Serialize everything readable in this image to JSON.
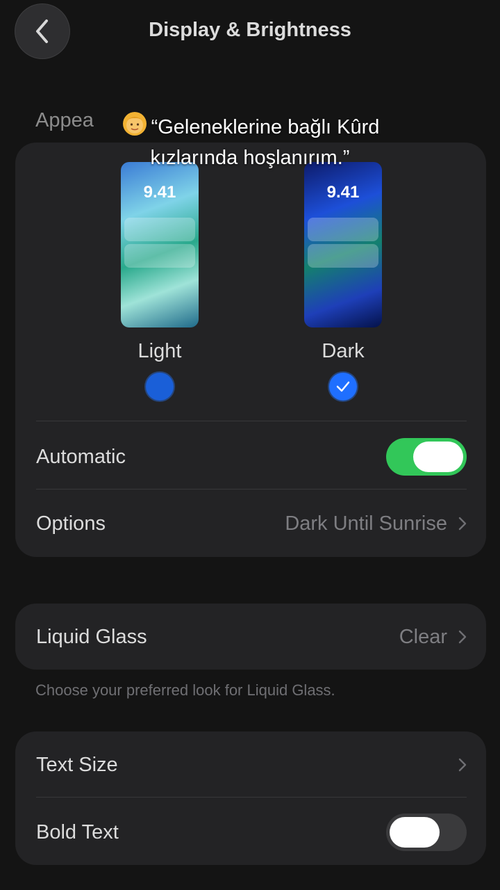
{
  "header": {
    "title": "Display & Brightness"
  },
  "appearance": {
    "section_label": "Appea",
    "overlay_line1": "“Geleneklerine bağlı Kûrd",
    "overlay_line2": "kızlarında hoşlanırım.”",
    "light": {
      "time": "9.41",
      "label": "Light",
      "selected": false
    },
    "dark": {
      "time": "9.41",
      "label": "Dark",
      "selected": true
    },
    "automatic": {
      "label": "Automatic",
      "on": true
    },
    "options": {
      "label": "Options",
      "value": "Dark Until Sunrise"
    }
  },
  "liquid_glass": {
    "label": "Liquid Glass",
    "value": "Clear",
    "note": "Choose your preferred look for Liquid Glass."
  },
  "text": {
    "text_size_label": "Text Size",
    "bold_text": {
      "label": "Bold Text",
      "on": false
    }
  },
  "colors": {
    "accent_blue": "#1f6fff",
    "toggle_on": "#32c759",
    "background": "#141414",
    "card": "#232325"
  }
}
